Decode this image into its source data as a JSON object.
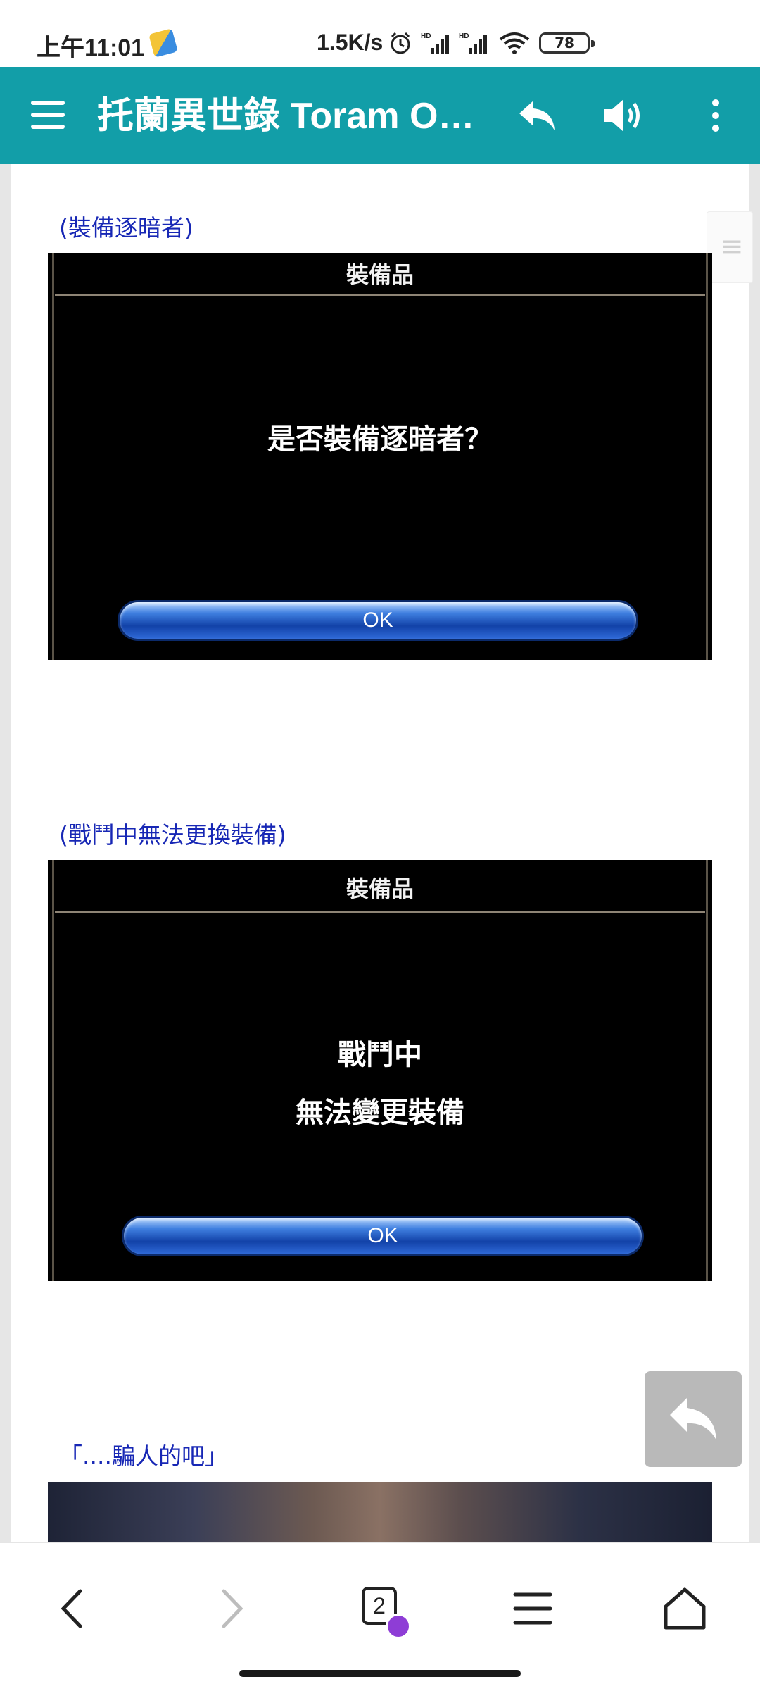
{
  "status_bar": {
    "time": "上午11:01",
    "net_speed": "1.5K/s",
    "battery_level": "78",
    "icons": [
      "app-notification-icon",
      "alarm-icon",
      "hd-signal-icon",
      "hd-signal-icon",
      "wifi-icon",
      "battery-icon"
    ]
  },
  "app_bar": {
    "title": "托蘭異世錄 Toram Online",
    "icons": [
      "menu-icon",
      "reply-icon",
      "speaker-icon",
      "more-vert-icon"
    ],
    "color": "#129ea8"
  },
  "content": {
    "caption1": "(裝備逐暗者)",
    "shot1": {
      "title": "裝備品",
      "message": "是否裝備逐暗者？",
      "button": "OK"
    },
    "caption2": "(戰鬥中無法更換裝備)",
    "shot2": {
      "title": "裝備品",
      "message_line1": "戰鬥中",
      "message_line2": "無法變更裝備",
      "button": "OK"
    },
    "caption3": "「....騙人的吧」",
    "caption_color": "#1727b5"
  },
  "bottom_nav": {
    "tab_count": "2",
    "icons": [
      "back-icon",
      "forward-icon",
      "tabs-icon",
      "menu-lines-icon",
      "home-icon"
    ]
  }
}
